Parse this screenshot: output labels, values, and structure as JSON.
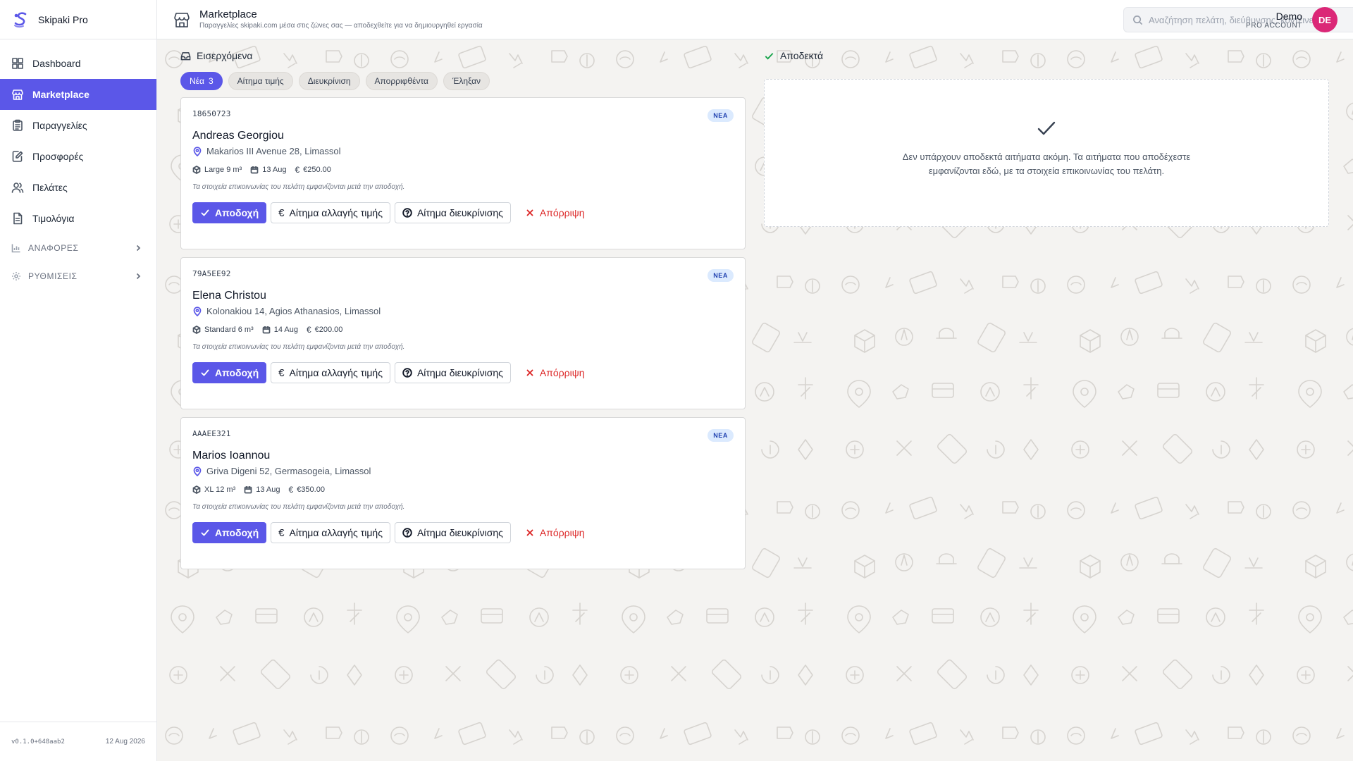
{
  "app": {
    "name": "Skipaki Pro"
  },
  "sidebar": {
    "items": [
      {
        "label": "Dashboard",
        "icon": "dashboard-icon"
      },
      {
        "label": "Marketplace",
        "icon": "store-icon",
        "active": true
      },
      {
        "label": "Παραγγελίες",
        "icon": "clipboard-icon"
      },
      {
        "label": "Προσφορές",
        "icon": "edit-document-icon"
      },
      {
        "label": "Πελάτες",
        "icon": "users-icon"
      },
      {
        "label": "Τιμολόγια",
        "icon": "invoice-icon"
      }
    ],
    "groups": [
      {
        "label": "ΑΝΑΦΟΡΕΣ",
        "icon": "bar-chart-icon"
      },
      {
        "label": "ΡΥΘΜΙΣΕΙΣ",
        "icon": "gear-icon"
      }
    ],
    "footer": {
      "version": "v0.1.0+648aab2",
      "date": "12 Aug 2026"
    }
  },
  "header": {
    "title": "Marketplace",
    "subtitle": "Παραγγελίες skipaki.com μέσα στις ζώνες σας — αποδεχθείτε για να δημιουργηθεί εργασία",
    "search_placeholder": "Αναζήτηση πελάτη, διεύθυνσης, κοντέινερ...",
    "user": {
      "name": "Demo",
      "role": "PRO ACCOUNT",
      "initials": "DE"
    }
  },
  "incoming": {
    "title": "Εισερχόμενα",
    "filters": [
      {
        "label": "Νέα",
        "count": "3",
        "active": true
      },
      {
        "label": "Αίτημα τιμής"
      },
      {
        "label": "Διευκρίνιση"
      },
      {
        "label": "Απορριφθέντα"
      },
      {
        "label": "Έληξαν"
      }
    ],
    "cards": [
      {
        "id": "18650723",
        "badge": "ΝΕΑ",
        "name": "Andreas Georgiou",
        "address": "Makarios III Avenue 28, Limassol",
        "size": "Large 9 m³",
        "date": "13 Aug",
        "price": "€250.00",
        "note": "Τα στοιχεία επικοινωνίας του πελάτη εμφανίζονται μετά την αποδοχή."
      },
      {
        "id": "79A5EE92",
        "badge": "ΝΕΑ",
        "name": "Elena Christou",
        "address": "Kolonakiou 14, Agios Athanasios, Limassol",
        "size": "Standard 6 m³",
        "date": "14 Aug",
        "price": "€200.00",
        "note": "Τα στοιχεία επικοινωνίας του πελάτη εμφανίζονται μετά την αποδοχή."
      },
      {
        "id": "AAAEE321",
        "badge": "ΝΕΑ",
        "name": "Marios Ioannou",
        "address": "Griva Digeni 52, Germasogeia, Limassol",
        "size": "XL 12 m³",
        "date": "13 Aug",
        "price": "€350.00",
        "note": "Τα στοιχεία επικοινωνίας του πελάτη εμφανίζονται μετά την αποδοχή."
      }
    ],
    "actions": {
      "accept": "Αποδοχή",
      "price_request": "Αίτημα αλλαγής τιμής",
      "clarification": "Αίτημα διευκρίνισης",
      "reject": "Απόρριψη"
    }
  },
  "accepted": {
    "title": "Αποδεκτά",
    "empty_text": "Δεν υπάρχουν αποδεκτά αιτήματα ακόμη. Τα αιτήματα που αποδέχεστε εμφανίζονται εδώ, με τα στοιχεία επικοινωνίας του πελάτη."
  },
  "colors": {
    "accent": "#5b57e8",
    "avatar": "#db2777",
    "reject": "#dc2626",
    "success": "#16a34a"
  }
}
